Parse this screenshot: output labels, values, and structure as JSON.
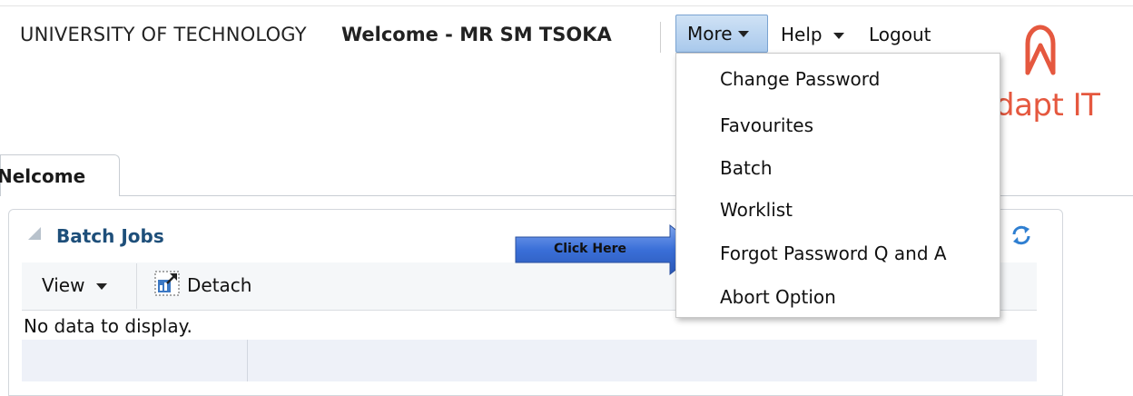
{
  "header": {
    "org": "UNIVERSITY OF TECHNOLOGY",
    "welcome": "Welcome - MR SM TSOKA",
    "menu_more": "More",
    "menu_help": "Help",
    "menu_logout": "Logout"
  },
  "logo": {
    "text": "dapt IT",
    "name": "adapt-it-logo",
    "color": "#e5583f"
  },
  "tabs": [
    {
      "label": "Nelcome"
    }
  ],
  "panel": {
    "title": "Batch Jobs",
    "toolbar": {
      "view_label": "View",
      "detach_label": "Detach"
    },
    "empty_text": "No data to display."
  },
  "callout": {
    "text": "Click Here",
    "color": "#3a6fd8"
  },
  "dropdown": {
    "items": [
      "Change Password",
      "Favourites",
      "Batch",
      "Worklist",
      "Forgot Password Q and A",
      "Abort Option"
    ]
  },
  "colors": {
    "accent": "#1e4f7a",
    "menu_active": "#a9c9ec"
  }
}
